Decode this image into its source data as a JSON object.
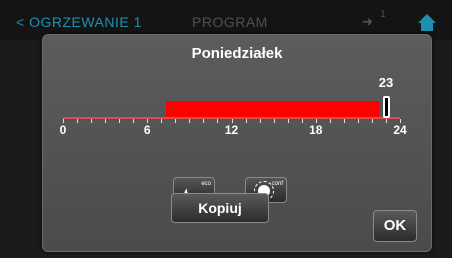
{
  "topbar": {
    "back_label": "< OGRZEWANIE 1",
    "program_label": "PROGRAM",
    "icon_left": "arrow-icon",
    "icon_right": "home-icon",
    "indicator_text": "1"
  },
  "dialog": {
    "title": "Poniedziałek",
    "timeline": {
      "axis_start_hour": 0,
      "axis_end_hour": 24,
      "ticks": [
        "0",
        "6",
        "12",
        "18",
        "24"
      ],
      "program_block": {
        "start_hour": 7.3,
        "end_hour": 22.5,
        "color": "#ff0000"
      },
      "marker": {
        "hour": 23,
        "label": "23"
      }
    },
    "mode_buttons": [
      {
        "icon": "moon-icon",
        "sub_label": "eco"
      },
      {
        "icon": "sun-icon",
        "sub_label": "conf"
      }
    ],
    "copy_label": "Kopiuj",
    "ok_label": "OK"
  },
  "colors": {
    "accent": "#1f8fb0",
    "program": "#ff0000",
    "dialog_bg": "#555555"
  }
}
